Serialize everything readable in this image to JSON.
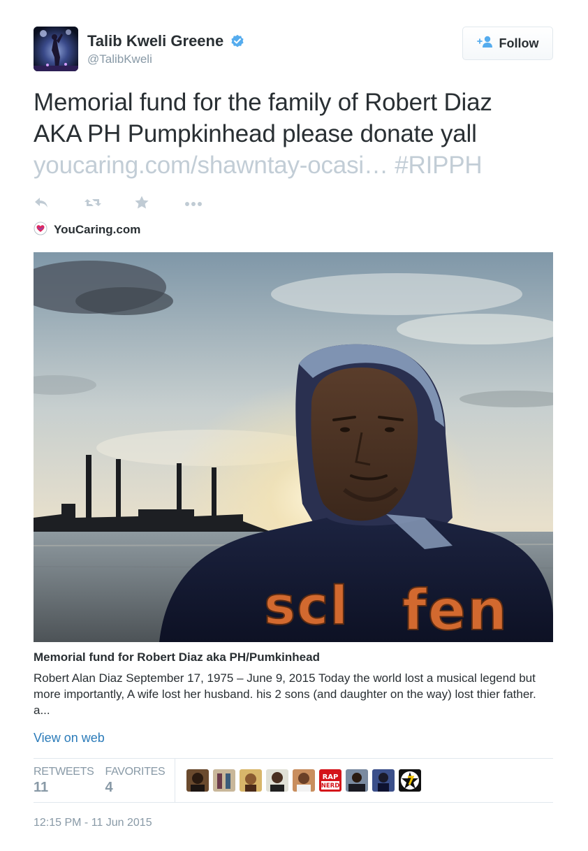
{
  "user": {
    "display_name": "Talib Kweli Greene",
    "handle": "@TalibKweli",
    "avatar_icon": "profile-photo",
    "verified_icon": "verified-badge-icon",
    "verified_color": "#55acee"
  },
  "follow_button": {
    "label": "Follow",
    "icon": "add-user-icon"
  },
  "tweet": {
    "text_line1": "Memorial fund for the family of Robert Diaz",
    "text_line2": "AKA PH Pumpkinhead please donate yall",
    "link": "youcaring.com/shawntay-ocasi…",
    "hashtag": "#RIPPH",
    "link_color": "#c2cdd6"
  },
  "actions": [
    "reply-icon",
    "retweet-icon",
    "favorite-star-icon",
    "more-dots-icon"
  ],
  "card": {
    "source_name": "YouCaring.com",
    "source_icon": "youcaring-logo-icon",
    "image_icon": "memorial-photo",
    "title": "Memorial fund for Robert Diaz aka PH/Pumkinhead",
    "description": "Robert Alan Diaz September 17, 1975 – June 9, 2015 Today the world lost a musical legend but more importantly, A wife lost her husband. his 2 sons (and daughter on the way) lost thier father. a...",
    "view_on_web": "View on web",
    "link_color": "#2b7bb9"
  },
  "stats": {
    "retweets_label": "RETWEETS",
    "retweets_count": "11",
    "favorites_label": "FAVORITES",
    "favorites_count": "4",
    "favoriter_avatars": [
      "avatar-1",
      "avatar-2",
      "avatar-3",
      "avatar-4",
      "avatar-5",
      "avatar-rap-nerd",
      "avatar-7",
      "avatar-8",
      "avatar-9"
    ],
    "rap_nerd_top": "RAP",
    "rap_nerd_bottom": "NERD"
  },
  "timestamp": "12:15 PM - 11 Jun 2015"
}
